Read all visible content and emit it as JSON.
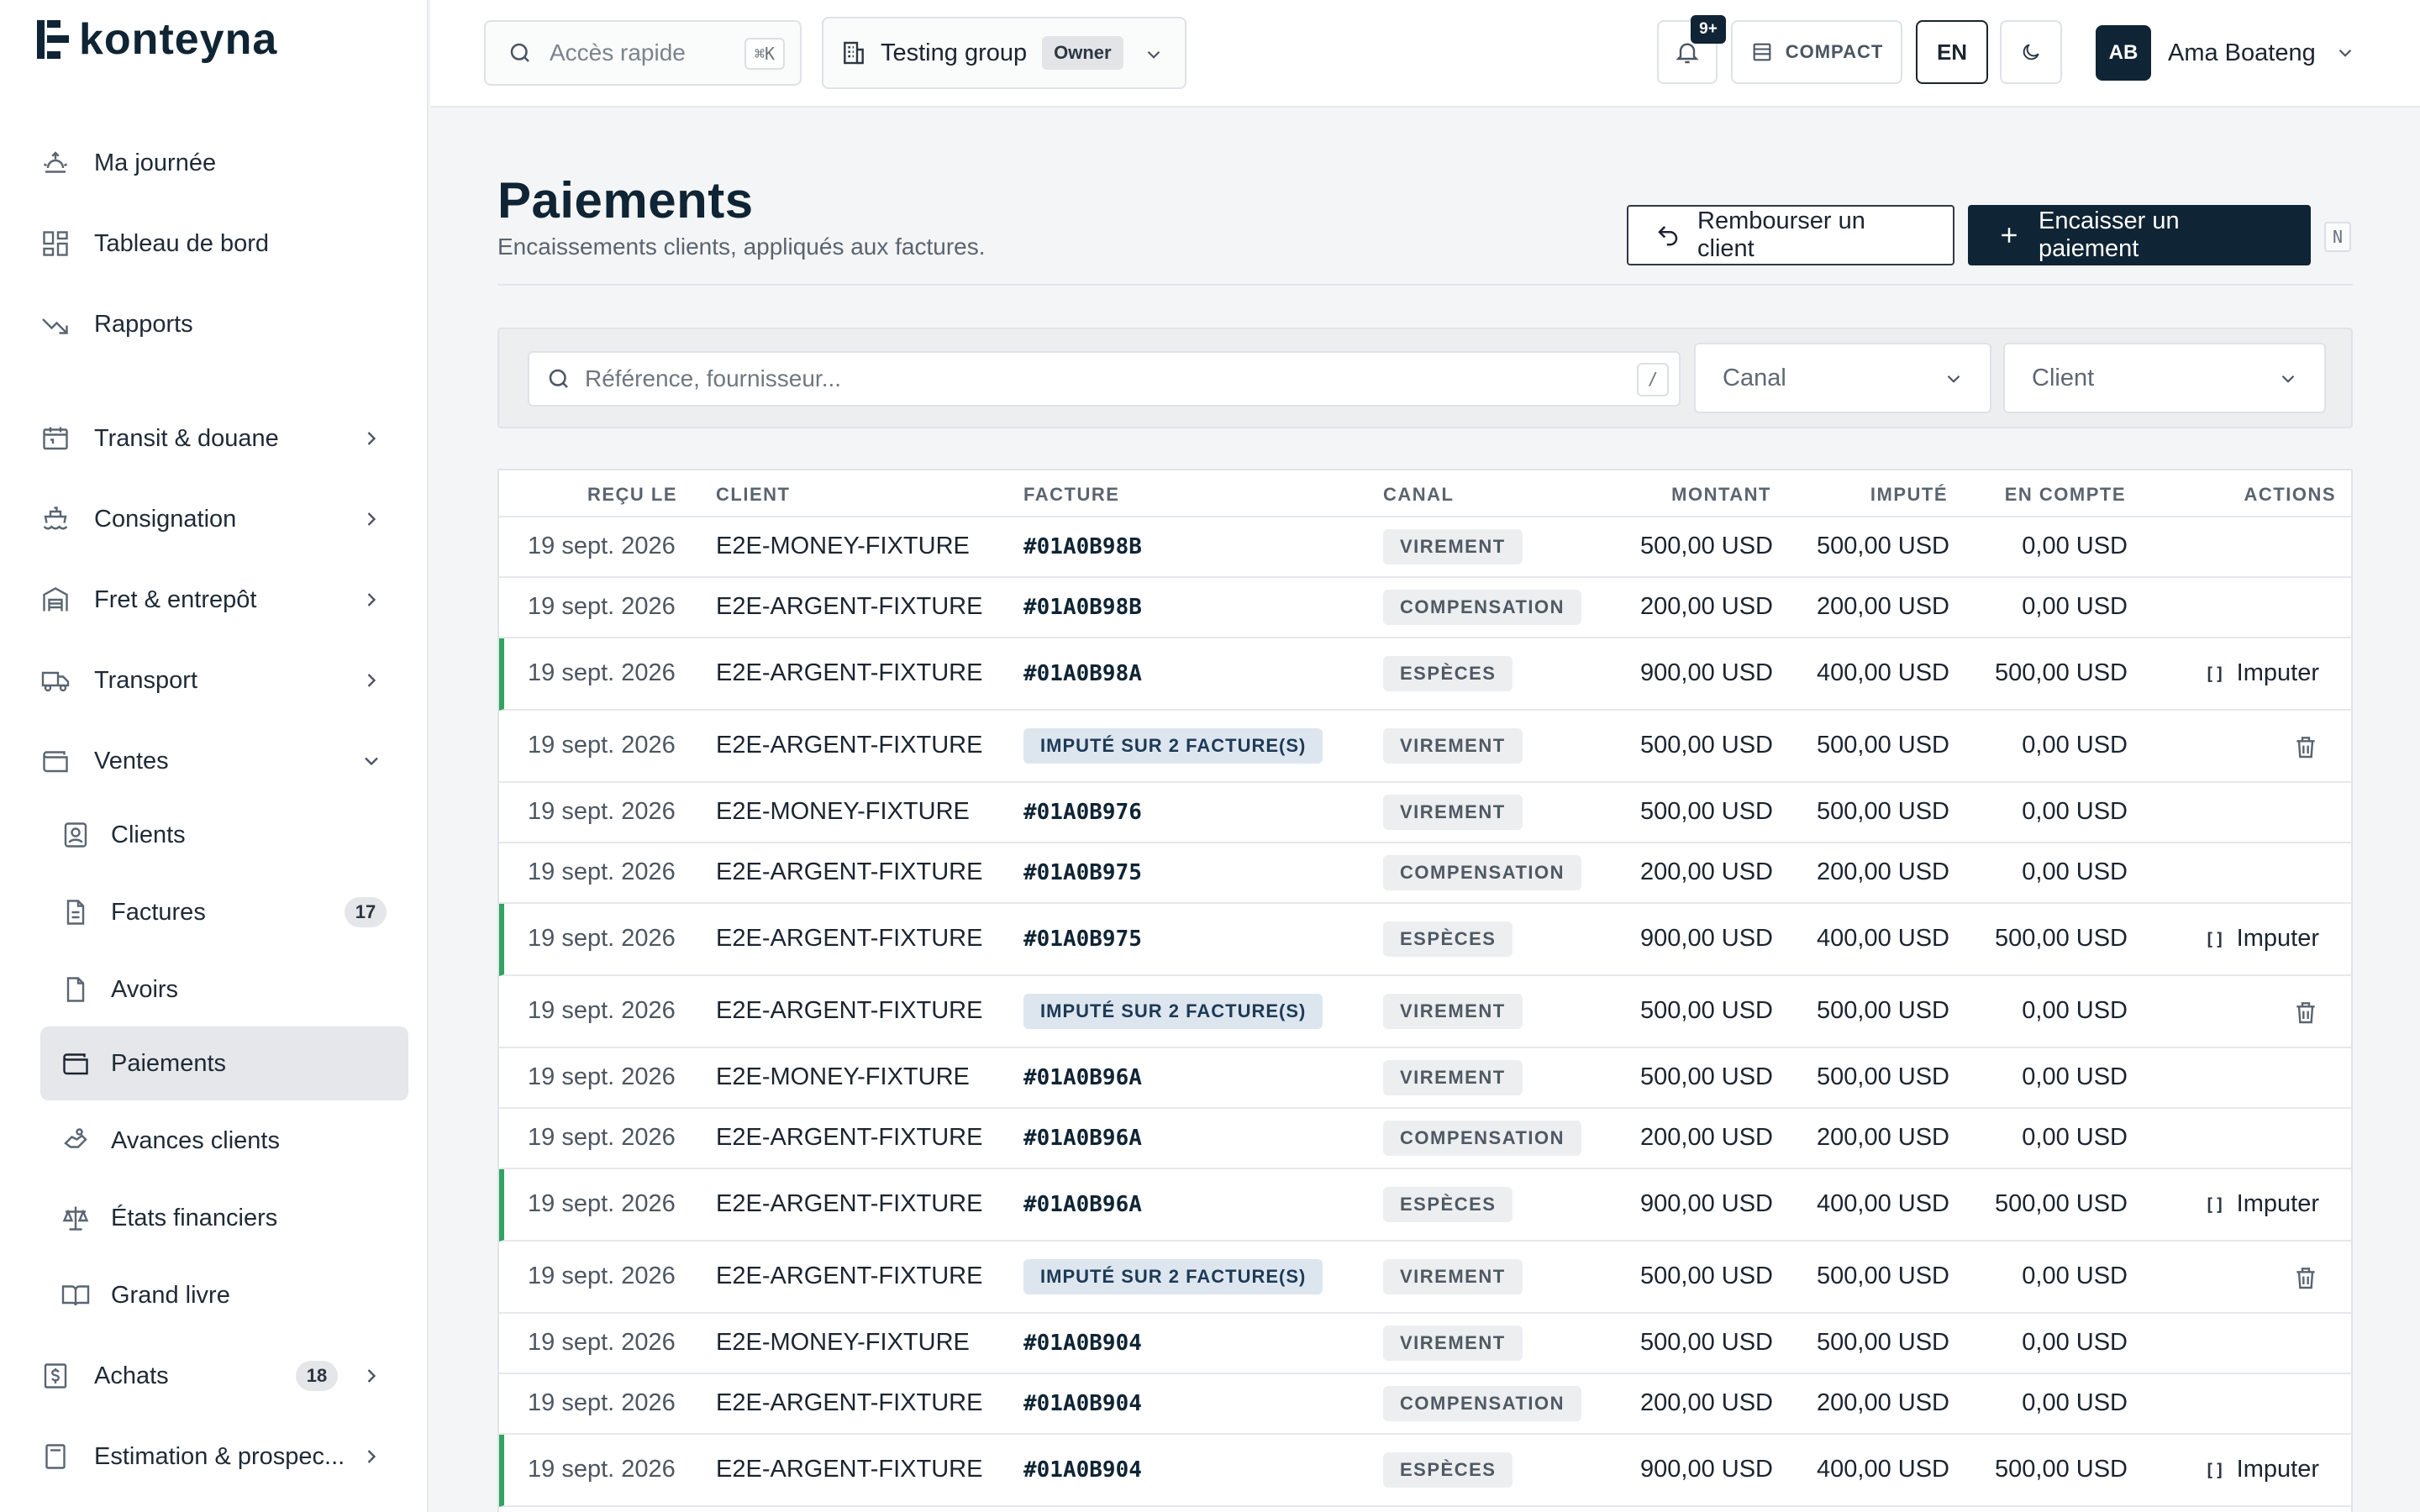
{
  "brand": {
    "name": "konteyna"
  },
  "sidebar": {
    "items": [
      {
        "label": "Ma journée",
        "icon": "sunrise-icon"
      },
      {
        "label": "Tableau de bord",
        "icon": "dashboard-icon"
      },
      {
        "label": "Rapports",
        "icon": "trending-down-icon"
      },
      {
        "label": "Transit & douane",
        "icon": "calendar-icon"
      },
      {
        "label": "Consignation",
        "icon": "ship-icon"
      },
      {
        "label": "Fret & entrepôt",
        "icon": "warehouse-icon"
      },
      {
        "label": "Transport",
        "icon": "truck-icon"
      },
      {
        "label": "Ventes",
        "icon": "wallet-icon"
      },
      {
        "label": "Clients",
        "icon": "contact-icon"
      },
      {
        "label": "Factures",
        "icon": "file-icon",
        "count": "17"
      },
      {
        "label": "Avoirs",
        "icon": "file-minus-icon"
      },
      {
        "label": "Paiements",
        "icon": "wallet-icon"
      },
      {
        "label": "Avances clients",
        "icon": "hand-coins-icon"
      },
      {
        "label": "États financiers",
        "icon": "scale-icon"
      },
      {
        "label": "Grand livre",
        "icon": "book-icon"
      },
      {
        "label": "Achats",
        "icon": "receipt-dollar-icon",
        "count": "18"
      },
      {
        "label": "Estimation & prospec...",
        "icon": "calculator-icon"
      }
    ]
  },
  "topbar": {
    "quick_access": "Accès rapide",
    "quick_kbd": "⌘K",
    "group_name": "Testing group",
    "group_role": "Owner",
    "notifications": "9+",
    "compact": "COMPACT",
    "lang": "EN",
    "user_initials": "AB",
    "user_name": "Ama Boateng"
  },
  "header": {
    "title": "Paiements",
    "subtitle": "Encaissements clients, appliqués aux factures.",
    "refund_label": "Rembourser un client",
    "collect_label": "Encaisser un paiement",
    "collect_kbd": "N"
  },
  "filters": {
    "search_placeholder": "Référence, fournisseur...",
    "search_kbd": "/",
    "channel": "Canal",
    "client": "Client"
  },
  "table": {
    "columns": [
      "REÇU LE",
      "CLIENT",
      "FACTURE",
      "CANAL",
      "MONTANT",
      "IMPUTÉ",
      "EN COMPTE",
      "ACTIONS"
    ],
    "rows": [
      {
        "date": "19 sept. 2026",
        "client": "E2E-MONEY-FIXTURE",
        "invoice": "#01A0B98B",
        "channel": "VIREMENT",
        "amount": "500,00 USD",
        "applied": "500,00 USD",
        "on_account": "0,00 USD"
      },
      {
        "date": "19 sept. 2026",
        "client": "E2E-ARGENT-FIXTURE",
        "invoice": "#01A0B98B",
        "channel": "COMPENSATION",
        "amount": "200,00 USD",
        "applied": "200,00 USD",
        "on_account": "0,00 USD"
      },
      {
        "date": "19 sept. 2026",
        "client": "E2E-ARGENT-FIXTURE",
        "invoice": "#01A0B98A",
        "channel": "ESPÈCES",
        "amount": "900,00 USD",
        "applied": "400,00 USD",
        "on_account": "500,00 USD",
        "action": "Imputer"
      },
      {
        "date": "19 sept. 2026",
        "client": "E2E-ARGENT-FIXTURE",
        "invoice_applied": "IMPUTÉ SUR 2 FACTURE(S)",
        "channel": "VIREMENT",
        "amount": "500,00 USD",
        "applied": "500,00 USD",
        "on_account": "0,00 USD"
      },
      {
        "date": "19 sept. 2026",
        "client": "E2E-MONEY-FIXTURE",
        "invoice": "#01A0B976",
        "channel": "VIREMENT",
        "amount": "500,00 USD",
        "applied": "500,00 USD",
        "on_account": "0,00 USD"
      },
      {
        "date": "19 sept. 2026",
        "client": "E2E-ARGENT-FIXTURE",
        "invoice": "#01A0B975",
        "channel": "COMPENSATION",
        "amount": "200,00 USD",
        "applied": "200,00 USD",
        "on_account": "0,00 USD"
      },
      {
        "date": "19 sept. 2026",
        "client": "E2E-ARGENT-FIXTURE",
        "invoice": "#01A0B975",
        "channel": "ESPÈCES",
        "amount": "900,00 USD",
        "applied": "400,00 USD",
        "on_account": "500,00 USD",
        "action": "Imputer"
      },
      {
        "date": "19 sept. 2026",
        "client": "E2E-ARGENT-FIXTURE",
        "invoice_applied": "IMPUTÉ SUR 2 FACTURE(S)",
        "channel": "VIREMENT",
        "amount": "500,00 USD",
        "applied": "500,00 USD",
        "on_account": "0,00 USD"
      },
      {
        "date": "19 sept. 2026",
        "client": "E2E-MONEY-FIXTURE",
        "invoice": "#01A0B96A",
        "channel": "VIREMENT",
        "amount": "500,00 USD",
        "applied": "500,00 USD",
        "on_account": "0,00 USD"
      },
      {
        "date": "19 sept. 2026",
        "client": "E2E-ARGENT-FIXTURE",
        "invoice": "#01A0B96A",
        "channel": "COMPENSATION",
        "amount": "200,00 USD",
        "applied": "200,00 USD",
        "on_account": "0,00 USD"
      },
      {
        "date": "19 sept. 2026",
        "client": "E2E-ARGENT-FIXTURE",
        "invoice": "#01A0B96A",
        "channel": "ESPÈCES",
        "amount": "900,00 USD",
        "applied": "400,00 USD",
        "on_account": "500,00 USD",
        "action": "Imputer"
      },
      {
        "date": "19 sept. 2026",
        "client": "E2E-ARGENT-FIXTURE",
        "invoice_applied": "IMPUTÉ SUR 2 FACTURE(S)",
        "channel": "VIREMENT",
        "amount": "500,00 USD",
        "applied": "500,00 USD",
        "on_account": "0,00 USD"
      },
      {
        "date": "19 sept. 2026",
        "client": "E2E-MONEY-FIXTURE",
        "invoice": "#01A0B904",
        "channel": "VIREMENT",
        "amount": "500,00 USD",
        "applied": "500,00 USD",
        "on_account": "0,00 USD"
      },
      {
        "date": "19 sept. 2026",
        "client": "E2E-ARGENT-FIXTURE",
        "invoice": "#01A0B904",
        "channel": "COMPENSATION",
        "amount": "200,00 USD",
        "applied": "200,00 USD",
        "on_account": "0,00 USD"
      },
      {
        "date": "19 sept. 2026",
        "client": "E2E-ARGENT-FIXTURE",
        "invoice": "#01A0B904",
        "channel": "ESPÈCES",
        "amount": "900,00 USD",
        "applied": "400,00 USD",
        "on_account": "500,00 USD",
        "action": "Imputer"
      }
    ]
  },
  "colors": {
    "brand_navy": "#0f2434",
    "accent_green": "#2fa463",
    "active_nav": "#e5e7ea"
  }
}
